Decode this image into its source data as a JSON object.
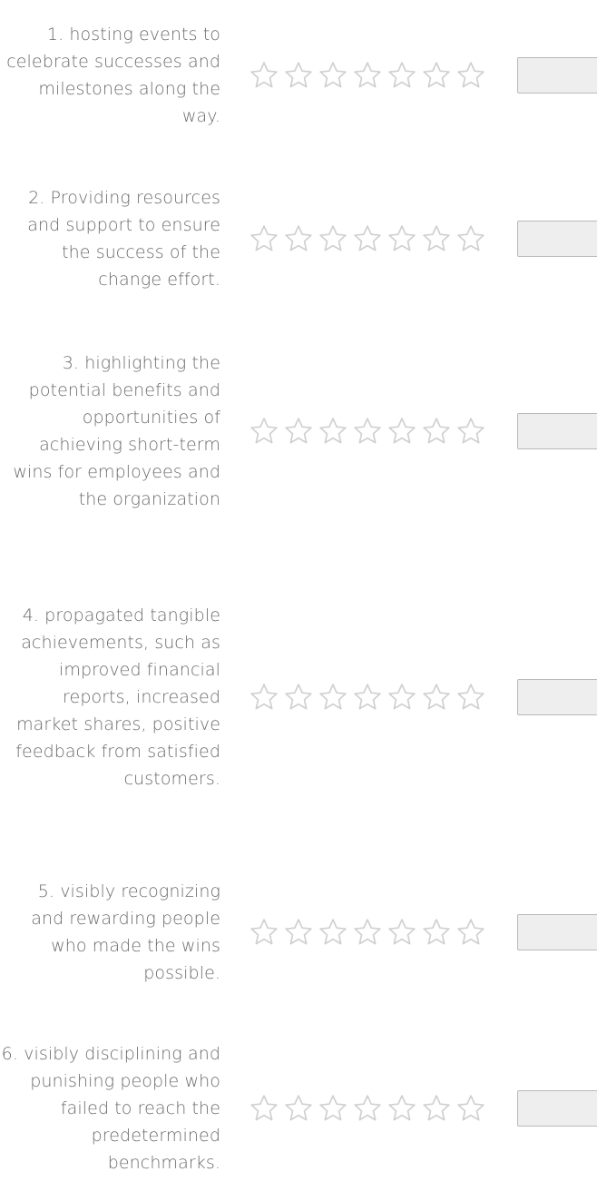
{
  "questions": [
    {
      "text": "1. hosting events to celebrate successes and milestones along the way.",
      "rating": 0,
      "max_stars": 7,
      "answer_value": ""
    },
    {
      "text": "2. Providing resources and support to ensure the success of the change effort.",
      "rating": 0,
      "max_stars": 7,
      "answer_value": ""
    },
    {
      "text": "3. highlighting the potential benefits and opportunities of achieving short-term wins for employees and the organization",
      "rating": 0,
      "max_stars": 7,
      "answer_value": ""
    },
    {
      "text": "4. propagated tangible achievements, such as improved financial reports, increased market shares, positive feedback from satisfied customers.",
      "rating": 0,
      "max_stars": 7,
      "answer_value": ""
    },
    {
      "text": "5. visibly recognizing and rewarding people who made the wins possible.",
      "rating": 0,
      "max_stars": 7,
      "answer_value": ""
    },
    {
      "text": "6. visibly disciplining and punishing people who failed to reach the predetermined benchmarks.",
      "rating": 0,
      "max_stars": 7,
      "answer_value": ""
    }
  ],
  "icons": {
    "star": "star-outline-icon"
  },
  "colors": {
    "star_outline": "#d0d0d0",
    "star_fill": "#ffffff",
    "label_text": "#6b6b6b",
    "box_bg": "#eeeeee",
    "box_border": "#b9b9b9"
  }
}
